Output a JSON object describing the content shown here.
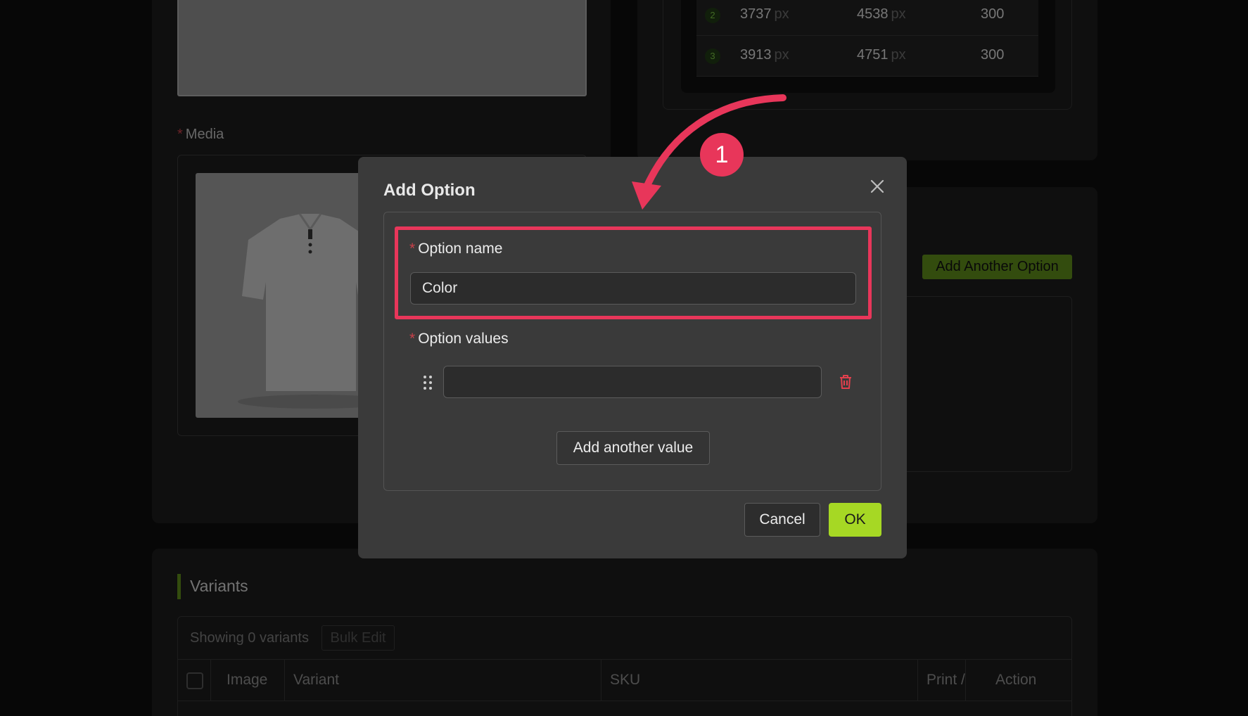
{
  "left_card": {
    "media_label": "Media"
  },
  "size_table": {
    "rows": [
      {
        "index": "2",
        "width": "3737",
        "height": "4538",
        "dpi": "300"
      },
      {
        "index": "3",
        "width": "3913",
        "height": "4751",
        "dpi": "300"
      }
    ],
    "unit": "px"
  },
  "options_card": {
    "add_another_option_label": "Add Another Option"
  },
  "variants": {
    "title": "Variants",
    "showing_text": "Showing 0 variants",
    "bulk_edit_label": "Bulk Edit",
    "columns": [
      "Image",
      "Variant",
      "SKU",
      "Print /",
      "Action"
    ]
  },
  "modal": {
    "title": "Add Option",
    "option_name_label": "Option name",
    "option_name_value": "Color",
    "option_values_label": "Option values",
    "option_value_input_value": "",
    "add_another_value_label": "Add another value",
    "cancel_label": "Cancel",
    "ok_label": "OK"
  },
  "annotation": {
    "step_number": "1"
  },
  "colors": {
    "accent_green": "#a6d824",
    "brand_green": "#5d8a1a",
    "highlight_red": "#e8365a",
    "required_red": "#c8414a"
  },
  "icons": [
    "close-icon",
    "drag-handle-icon",
    "trash-icon",
    "tshirt-image"
  ]
}
